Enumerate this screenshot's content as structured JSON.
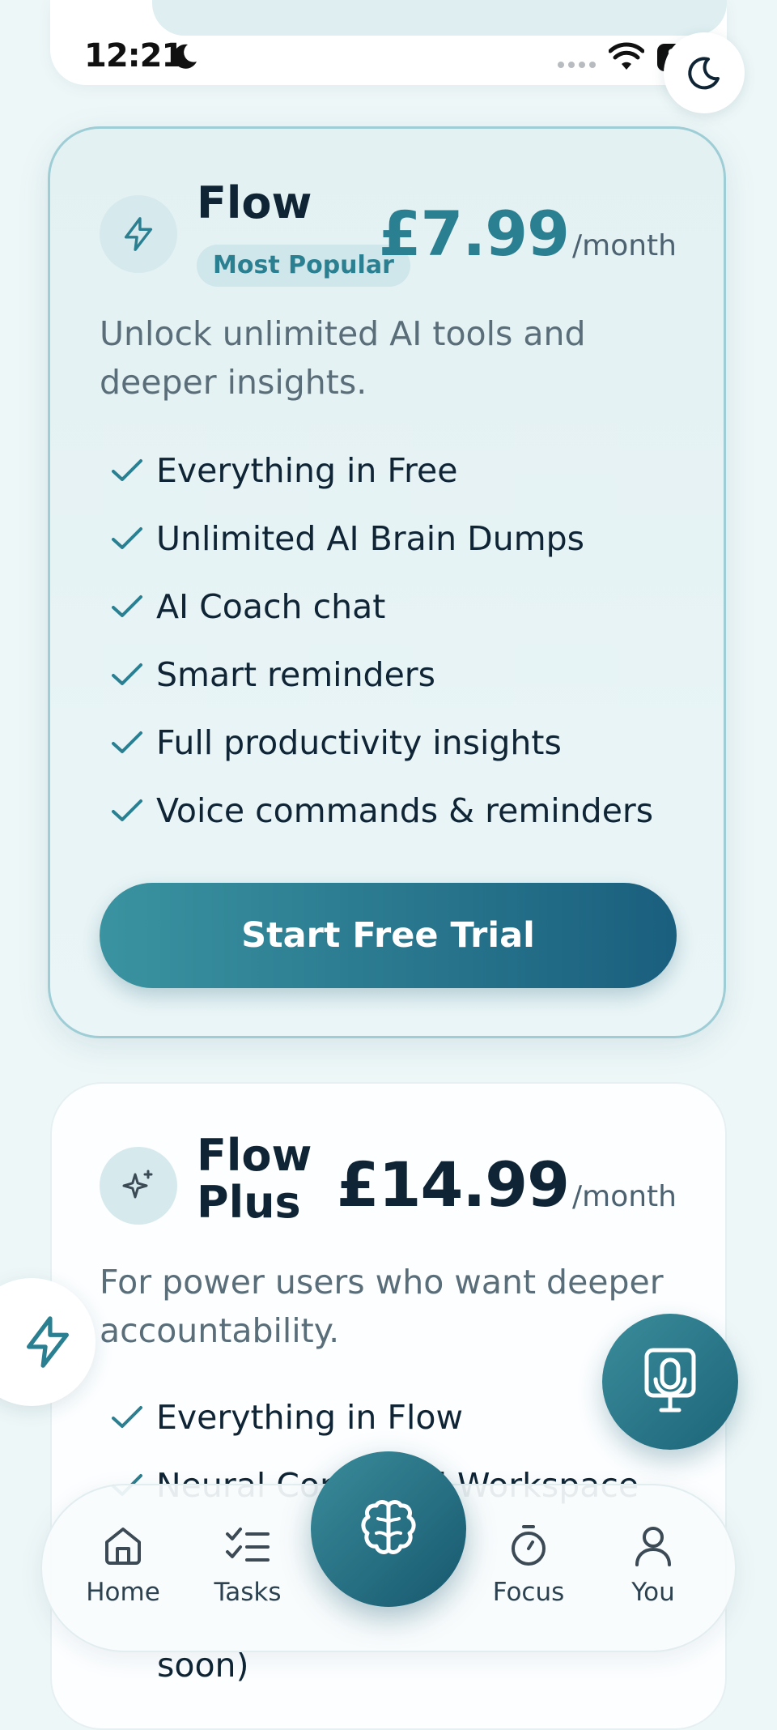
{
  "status_bar": {
    "time": "12:21",
    "battery": "87"
  },
  "plans": {
    "flow": {
      "name": "Flow",
      "badge": "Most Popular",
      "price": "£7.99",
      "period": "/month",
      "description": "Unlock unlimited AI tools and deeper insights.",
      "features": [
        "Everything in Free",
        "Unlimited AI Brain Dumps",
        "AI Coach chat",
        "Smart reminders",
        "Full productivity insights",
        "Voice commands & reminders"
      ],
      "cta": "Start Free Trial"
    },
    "flow_plus": {
      "name_line1": "Flow",
      "name_line2": "Plus",
      "price": "£14.99",
      "period": "/month",
      "description": "For power users who want deeper accountability.",
      "features": [
        "Everything in Flow",
        "Neural Command Workspace"
      ],
      "trailing_text": "soon)"
    }
  },
  "nav": {
    "home": "Home",
    "tasks": "Tasks",
    "focus": "Focus",
    "you": "You"
  },
  "colors": {
    "accent": "#2a7f90",
    "accent_dark": "#1a5f7e",
    "background": "#eef7f8"
  }
}
